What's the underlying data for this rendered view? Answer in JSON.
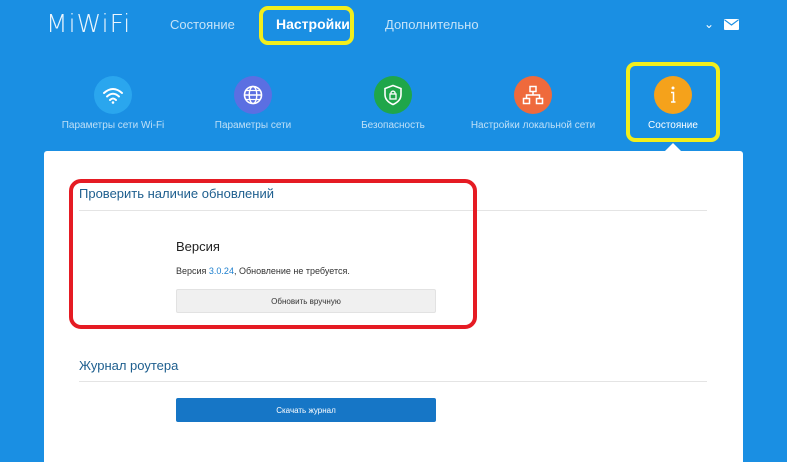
{
  "app": {
    "logo": "MiWiFi"
  },
  "topnav": {
    "status_label": "Состояние",
    "settings_label": "Настройки",
    "advanced_label": "Дополнительно"
  },
  "categories": [
    {
      "label": "Параметры сети Wi-Fi",
      "icon": "wifi-icon",
      "color": "#2aa6ee"
    },
    {
      "label": "Параметры сети",
      "icon": "globe-icon",
      "color": "#5b6fe2"
    },
    {
      "label": "Безопасность",
      "icon": "shield-lock-icon",
      "color": "#1fa64a"
    },
    {
      "label": "Настройки локальной сети",
      "icon": "network-icon",
      "color": "#ef6a3c"
    },
    {
      "label": "Состояние",
      "icon": "info-icon",
      "color": "#f5a21b"
    }
  ],
  "update_section": {
    "title": "Проверить наличие обновлений",
    "version_heading": "Версия",
    "version_prefix": "Версия ",
    "version_number": "3.0.24",
    "version_suffix": ", Обновление не требуется.",
    "manual_update_button": "Обновить вручную"
  },
  "log_section": {
    "title": "Журнал роутера",
    "download_button": "Скачать журнал"
  },
  "colors": {
    "background": "#1a8fe3",
    "highlight_yellow": "#f2ee1c",
    "highlight_red": "#e51b23",
    "primary_button": "#1676c6"
  }
}
